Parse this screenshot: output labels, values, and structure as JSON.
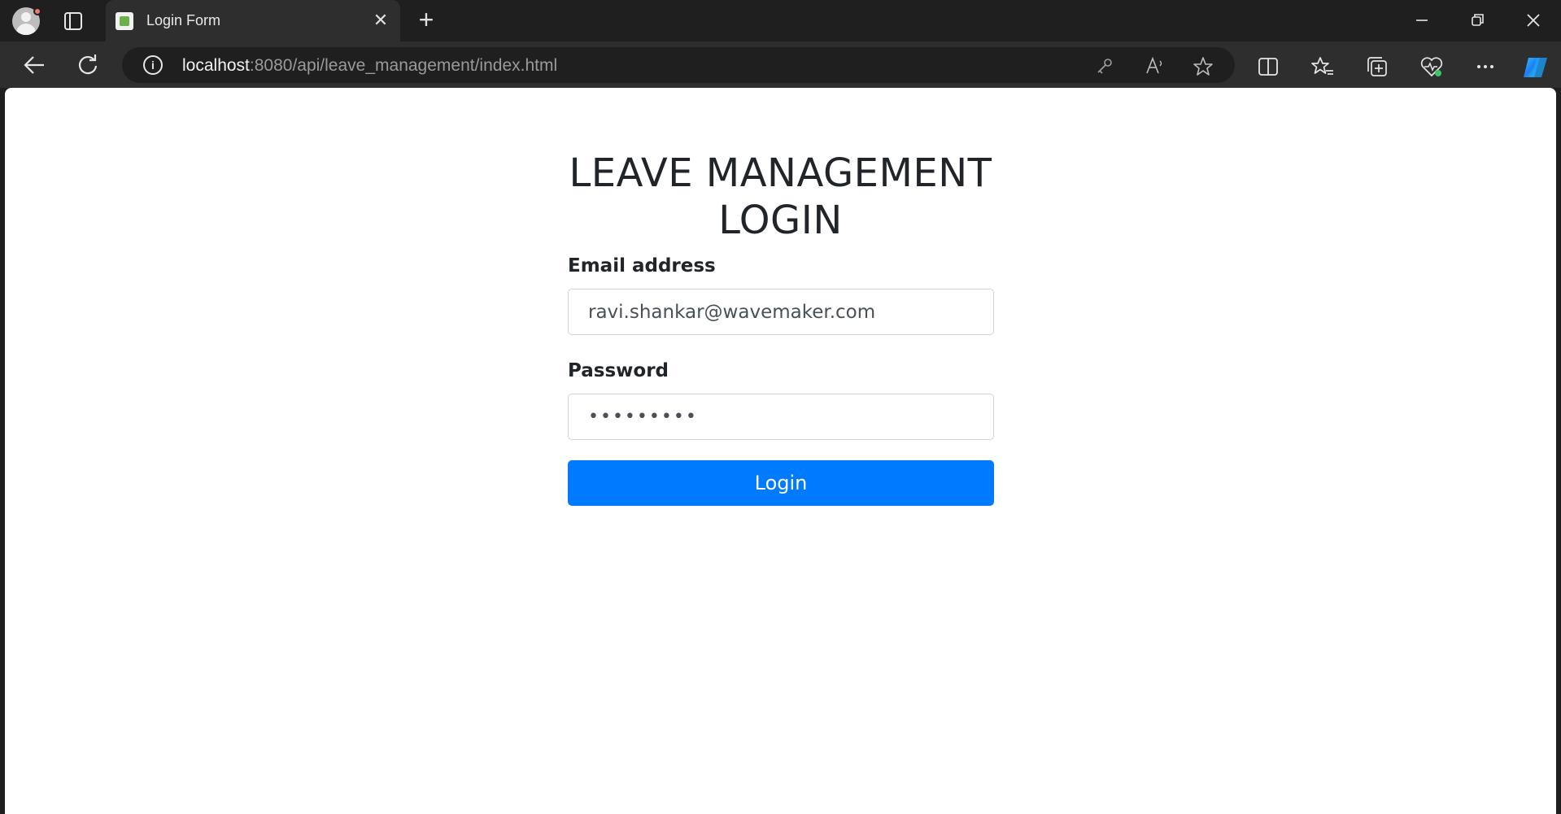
{
  "browser": {
    "tab_title": "Login Form",
    "url_host": "localhost",
    "url_rest": ":8080/api/leave_management/index.html"
  },
  "page": {
    "heading_line1": "LEAVE MANAGEMENT",
    "heading_line2": "LOGIN",
    "email_label": "Email address",
    "email_value": "ravi.shankar@wavemaker.com",
    "password_label": "Password",
    "password_value": "•••••••••",
    "login_label": "Login"
  },
  "colors": {
    "accent": "#007bff",
    "text": "#212529"
  }
}
